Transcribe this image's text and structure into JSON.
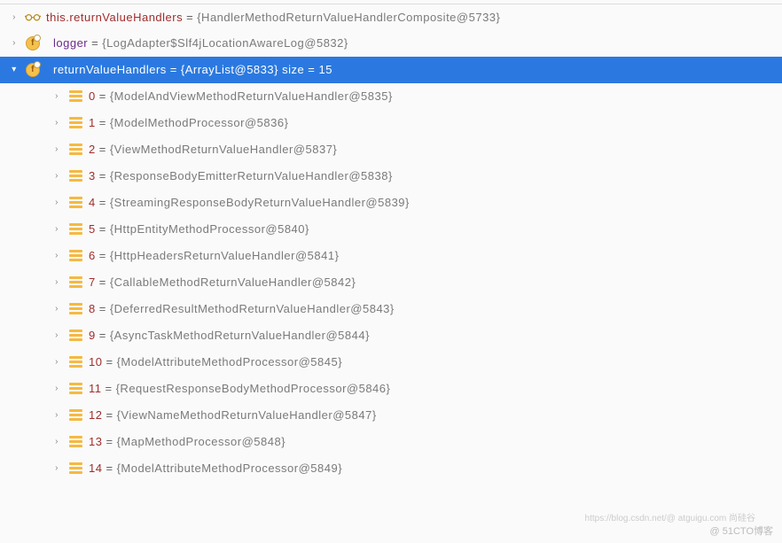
{
  "rows": [
    {
      "kind": "glasses",
      "depth": 0,
      "expanded": false,
      "namePurple": false,
      "name": "this.returnValueHandlers",
      "value": "{HandlerMethodReturnValueHandlerComposite@5733}",
      "selected": false
    },
    {
      "kind": "field",
      "depth": 0,
      "expanded": false,
      "namePurple": true,
      "name": "logger",
      "value": "{LogAdapter$Slf4jLocationAwareLog@5832}",
      "selected": false
    },
    {
      "kind": "field",
      "depth": 0,
      "expanded": true,
      "namePurple": true,
      "name": "returnValueHandlers",
      "value": "{ArrayList@5833}  size = 15",
      "selected": true
    },
    {
      "kind": "array",
      "depth": 1,
      "expanded": false,
      "namePurple": false,
      "name": "0",
      "value": "{ModelAndViewMethodReturnValueHandler@5835}",
      "selected": false
    },
    {
      "kind": "array",
      "depth": 1,
      "expanded": false,
      "namePurple": false,
      "name": "1",
      "value": "{ModelMethodProcessor@5836}",
      "selected": false
    },
    {
      "kind": "array",
      "depth": 1,
      "expanded": false,
      "namePurple": false,
      "name": "2",
      "value": "{ViewMethodReturnValueHandler@5837}",
      "selected": false
    },
    {
      "kind": "array",
      "depth": 1,
      "expanded": false,
      "namePurple": false,
      "name": "3",
      "value": "{ResponseBodyEmitterReturnValueHandler@5838}",
      "selected": false
    },
    {
      "kind": "array",
      "depth": 1,
      "expanded": false,
      "namePurple": false,
      "name": "4",
      "value": "{StreamingResponseBodyReturnValueHandler@5839}",
      "selected": false
    },
    {
      "kind": "array",
      "depth": 1,
      "expanded": false,
      "namePurple": false,
      "name": "5",
      "value": "{HttpEntityMethodProcessor@5840}",
      "selected": false
    },
    {
      "kind": "array",
      "depth": 1,
      "expanded": false,
      "namePurple": false,
      "name": "6",
      "value": "{HttpHeadersReturnValueHandler@5841}",
      "selected": false
    },
    {
      "kind": "array",
      "depth": 1,
      "expanded": false,
      "namePurple": false,
      "name": "7",
      "value": "{CallableMethodReturnValueHandler@5842}",
      "selected": false
    },
    {
      "kind": "array",
      "depth": 1,
      "expanded": false,
      "namePurple": false,
      "name": "8",
      "value": "{DeferredResultMethodReturnValueHandler@5843}",
      "selected": false
    },
    {
      "kind": "array",
      "depth": 1,
      "expanded": false,
      "namePurple": false,
      "name": "9",
      "value": "{AsyncTaskMethodReturnValueHandler@5844}",
      "selected": false
    },
    {
      "kind": "array",
      "depth": 1,
      "expanded": false,
      "namePurple": false,
      "name": "10",
      "value": "{ModelAttributeMethodProcessor@5845}",
      "selected": false
    },
    {
      "kind": "array",
      "depth": 1,
      "expanded": false,
      "namePurple": false,
      "name": "11",
      "value": "{RequestResponseBodyMethodProcessor@5846}",
      "selected": false
    },
    {
      "kind": "array",
      "depth": 1,
      "expanded": false,
      "namePurple": false,
      "name": "12",
      "value": "{ViewNameMethodReturnValueHandler@5847}",
      "selected": false
    },
    {
      "kind": "array",
      "depth": 1,
      "expanded": false,
      "namePurple": false,
      "name": "13",
      "value": "{MapMethodProcessor@5848}",
      "selected": false
    },
    {
      "kind": "array",
      "depth": 1,
      "expanded": false,
      "namePurple": false,
      "name": "14",
      "value": "{ModelAttributeMethodProcessor@5849}",
      "selected": false
    }
  ],
  "watermark_main": "@ 51CTO博客",
  "watermark_sub": "https://blog.csdn.net/@ atguigu.com 尚硅谷"
}
